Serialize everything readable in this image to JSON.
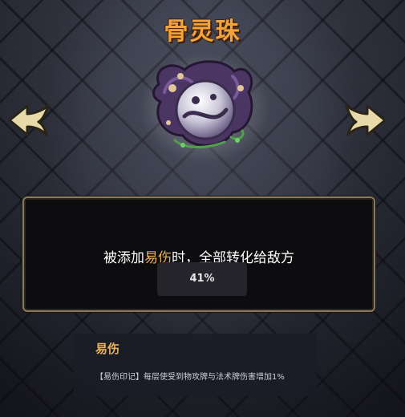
{
  "relic": {
    "name": "骨灵珠",
    "icon": "purple-crystal-orb-icon"
  },
  "navigation": {
    "prev_icon": "arrow-left-icon",
    "next_icon": "arrow-right-icon"
  },
  "description": {
    "prefix": "被添加",
    "keyword": "易伤",
    "suffix": "时，全部转化给敌方",
    "keyword_color": "#e9b25a"
  },
  "progress": {
    "label": "41%",
    "value": 0.41
  },
  "tooltip": {
    "title": "易伤",
    "body": "【易伤印记】每层使受到物攻牌与法术牌伤害增加1%"
  },
  "colors": {
    "title": "#f2a43a",
    "border": "#8a7a5e",
    "arrow": "#e8d9a8"
  }
}
